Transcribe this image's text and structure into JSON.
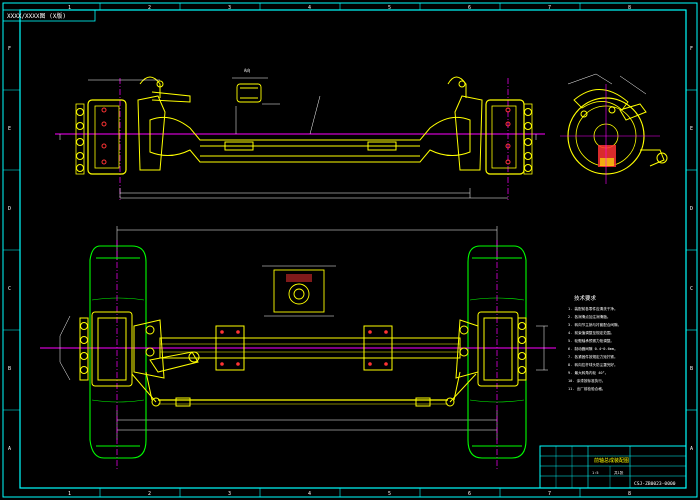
{
  "header_label": "XXXX/XXXX图 (X版)",
  "border": {
    "top_numbers": [
      "1",
      "2",
      "3",
      "4",
      "5",
      "6",
      "7",
      "8"
    ],
    "bottom_numbers": [
      "1",
      "2",
      "3",
      "4",
      "5",
      "6",
      "7",
      "8"
    ],
    "left_letters": [
      "F",
      "E",
      "D",
      "C",
      "B",
      "A"
    ],
    "right_letters": [
      "F",
      "E",
      "D",
      "C",
      "B",
      "A"
    ]
  },
  "tech_requirements": {
    "title": "技术要求",
    "lines": [
      "1. 装配前各零件应清洗干净。",
      "2. 各润滑点加注润滑脂。",
      "3. 转向节主销与衬套配合间隙。",
      "4. 前束值调整至规定范围。",
      "5. 轮毂轴承预紧力矩调整。",
      "6. 制动器间隙 0.4~0.6mm。",
      "7. 各紧固件按规定力矩拧紧。",
      "8. 转向拉杆球头防尘罩完好。",
      "9. 最大转角内轮 40°。",
      "10. 涂漆按标准执行。",
      "11. 出厂前检验合格。"
    ]
  },
  "title_block": {
    "name": "前轴总成装配图",
    "drawing_number": "CSJ-ZB0023-0000",
    "scale": "1:5",
    "sheet": "共1张"
  },
  "colors": {
    "background": "#000000",
    "border": "#00ffff",
    "outline": "#ffff00",
    "center": "#ff00ff",
    "dimension": "#ffffff",
    "wheel": "#00ff00"
  }
}
